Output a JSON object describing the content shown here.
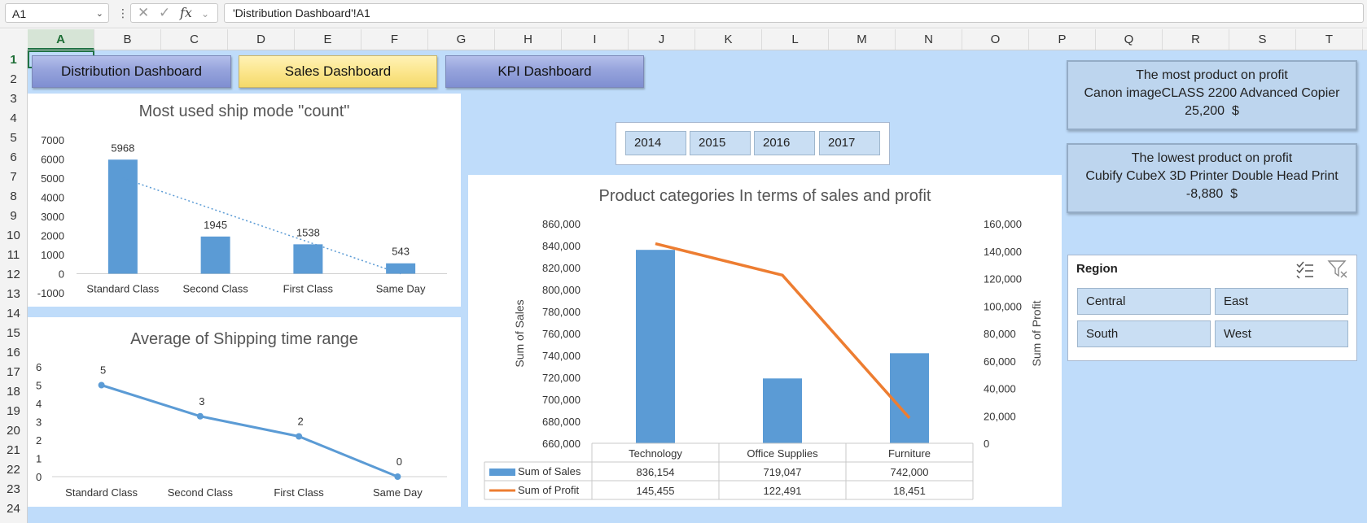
{
  "formula_bar": {
    "name_box": "A1",
    "formula": "'Distribution Dashboard'!A1"
  },
  "columns": [
    "A",
    "B",
    "C",
    "D",
    "E",
    "F",
    "G",
    "H",
    "I",
    "J",
    "K",
    "L",
    "M",
    "N",
    "O",
    "P",
    "Q",
    "R",
    "S",
    "T"
  ],
  "rows": [
    "1",
    "2",
    "3",
    "4",
    "5",
    "6",
    "7",
    "8",
    "9",
    "10",
    "11",
    "12",
    "13",
    "14",
    "15",
    "16",
    "17",
    "18",
    "19",
    "20",
    "21",
    "22",
    "23",
    "24"
  ],
  "nav": {
    "distribution": "Distribution Dashboard",
    "sales": "Sales Dashboard",
    "kpi": "KPI Dashboard"
  },
  "year_slicer": {
    "years": [
      "2014",
      "2015",
      "2016",
      "2017"
    ]
  },
  "profit_boxes": {
    "most": {
      "heading": "The most product on profit",
      "product": "Canon imageCLASS 2200 Advanced Copier",
      "value": "25,200  $"
    },
    "lowest": {
      "heading": "The lowest product on profit",
      "product": "Cubify CubeX 3D Printer Double Head Print",
      "value": "-8,880  $"
    }
  },
  "region_slicer": {
    "title": "Region",
    "items": [
      "Central",
      "East",
      "South",
      "West"
    ],
    "icons": [
      "multi-select-icon",
      "clear-filter-icon"
    ]
  },
  "chart_data": [
    {
      "type": "bar",
      "title": "Most used ship mode \"count\"",
      "categories": [
        "Standard Class",
        "Second Class",
        "First Class",
        "Same Day"
      ],
      "values": [
        5968,
        1945,
        1538,
        543
      ],
      "data_labels": [
        "5968",
        "1945",
        "1538",
        "543"
      ],
      "yticks": [
        "-1000",
        "0",
        "1000",
        "2000",
        "3000",
        "4000",
        "5000",
        "6000",
        "7000"
      ],
      "ylim": [
        -1000,
        7000
      ],
      "trendline": "linear-dotted",
      "color": "#5b9bd5"
    },
    {
      "type": "line",
      "title": "Average of Shipping time range",
      "categories": [
        "Standard Class",
        "Second Class",
        "First Class",
        "Same Day"
      ],
      "values": [
        5,
        3.3,
        2.2,
        0
      ],
      "data_labels": [
        "5",
        "3",
        "2",
        "0"
      ],
      "yticks": [
        "0",
        "1",
        "2",
        "3",
        "4",
        "5",
        "6"
      ],
      "ylim": [
        0,
        6
      ],
      "color": "#5b9bd5"
    },
    {
      "type": "bar",
      "title": "Product categories In terms of sales and profit",
      "categories": [
        "Technology",
        "Office Supplies",
        "Furniture"
      ],
      "series": [
        {
          "name": "Sum of Sales",
          "type": "bar",
          "axis": "left",
          "values": [
            836154,
            719047,
            742000
          ],
          "labels": [
            "836,154",
            "719,047",
            "742,000"
          ],
          "color": "#5b9bd5"
        },
        {
          "name": "Sum of Profit",
          "type": "line",
          "axis": "right",
          "values": [
            145455,
            122491,
            18451
          ],
          "labels": [
            "145,455",
            "122,491",
            "18,451"
          ],
          "color": "#ed7d31"
        }
      ],
      "ylabel": "Sum of Sales",
      "y2label": "Sum of Profit",
      "ylim": [
        660000,
        860000
      ],
      "y2lim": [
        0,
        160000
      ],
      "yticks": [
        "660,000",
        "680,000",
        "700,000",
        "720,000",
        "740,000",
        "760,000",
        "780,000",
        "800,000",
        "820,000",
        "840,000",
        "860,000"
      ],
      "y2ticks": [
        "0",
        "20,000",
        "40,000",
        "60,000",
        "80,000",
        "100,000",
        "120,000",
        "140,000",
        "160,000"
      ],
      "data_table": true
    }
  ]
}
